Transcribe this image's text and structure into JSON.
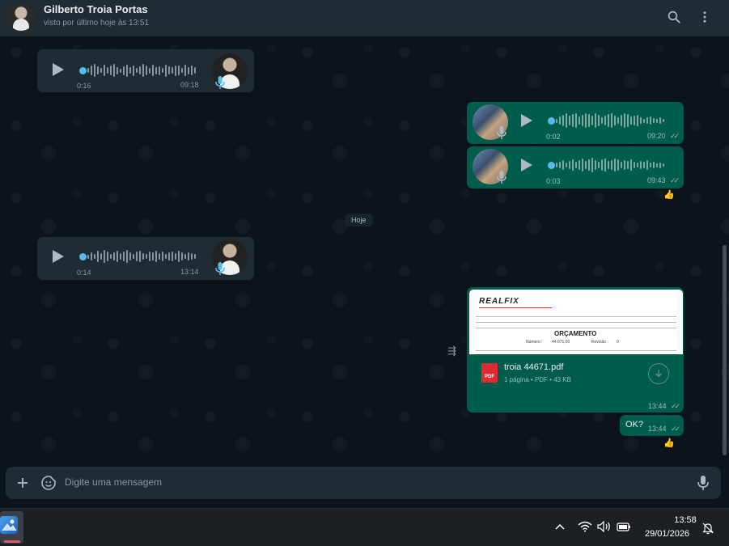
{
  "header": {
    "contact_name": "Gilberto Troia Portas",
    "contact_status": "visto por último hoje às 13:51",
    "icons": [
      "search-icon",
      "menu-dots-icon"
    ]
  },
  "messages": [
    {
      "kind": "voice",
      "direction": "in",
      "duration": "0:16",
      "time": "09:18"
    },
    {
      "kind": "voice",
      "direction": "out",
      "duration": "0:02",
      "time": "09:20"
    },
    {
      "kind": "voice",
      "direction": "out",
      "duration": "0:03",
      "time": "09:43",
      "reaction": "👍"
    },
    {
      "kind": "date",
      "label": "Hoje"
    },
    {
      "kind": "voice",
      "direction": "in",
      "duration": "0:14",
      "time": "13:14"
    },
    {
      "kind": "document",
      "direction": "out",
      "preview": {
        "logo": "REALFIX",
        "title": "ORÇAMENTO",
        "numero_label": "Número :",
        "numero": "44.671,00",
        "revisao_label": "Revisão :",
        "revisao": "0"
      },
      "file_name": "troia 44671.pdf",
      "file_meta": "1 página • PDF • 43 KB",
      "file_badge": "PDF",
      "time": "13:44"
    },
    {
      "kind": "text",
      "direction": "out",
      "text": "OK?",
      "time": "13:44",
      "reaction": "👍"
    }
  ],
  "composer": {
    "placeholder": "Digite uma mensagem"
  },
  "taskbar": {
    "time": "13:58",
    "date": "29/01/2026"
  },
  "colors": {
    "background": "#0b141a",
    "header": "#202c33",
    "incoming": "#202c33",
    "outgoing": "#005c4b",
    "accent": "#53bdeb"
  }
}
